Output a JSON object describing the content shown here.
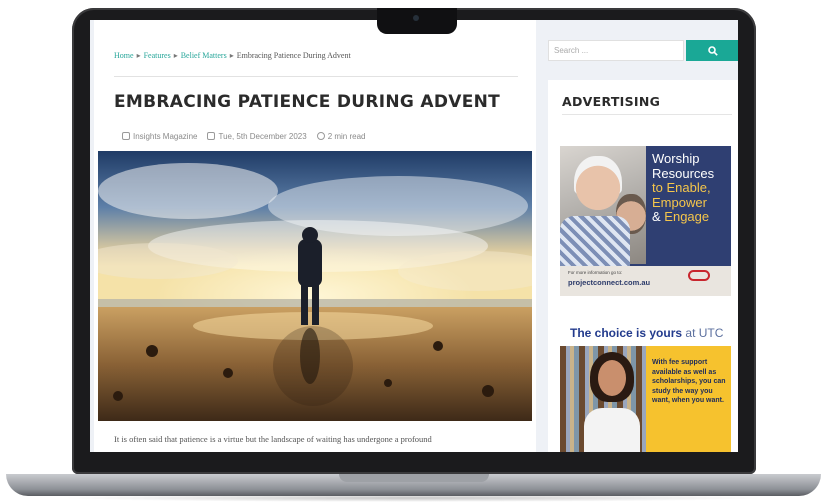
{
  "breadcrumb": {
    "home": "Home",
    "features": "Features",
    "belief_matters": "Belief Matters",
    "current": "Embracing Patience During Advent",
    "separator": "▸"
  },
  "article": {
    "title": "EMBRACING PATIENCE DURING ADVENT",
    "author": "Insights Magazine",
    "date": "Tue, 5th December 2023",
    "read_time": "2 min read",
    "excerpt": "It is often said that patience is a virtue but the landscape of waiting has undergone a profound"
  },
  "sidebar": {
    "search_placeholder": "Search ...",
    "search_icon": "search-icon",
    "advertising_title": "ADVERTISING",
    "ad1": {
      "line1": "Worship",
      "line2": "Resources",
      "line3a": "to",
      "line3b": "Enable,",
      "line4": "Empower",
      "line5a": "&",
      "line5b": "Engage",
      "foot_small": "For more information go to:",
      "url": "projectconnect.com.au"
    },
    "ad2": {
      "head_bold": "The choice is yours",
      "head_light": "at UTC",
      "line": "With fee support available as well as scholarships, you can study the way you want, when you want."
    }
  },
  "colors": {
    "accent": "#1aa896",
    "link": "#27a69a",
    "ad1_bg": "#2f3f72",
    "ad2_bg": "#f6c22e"
  }
}
